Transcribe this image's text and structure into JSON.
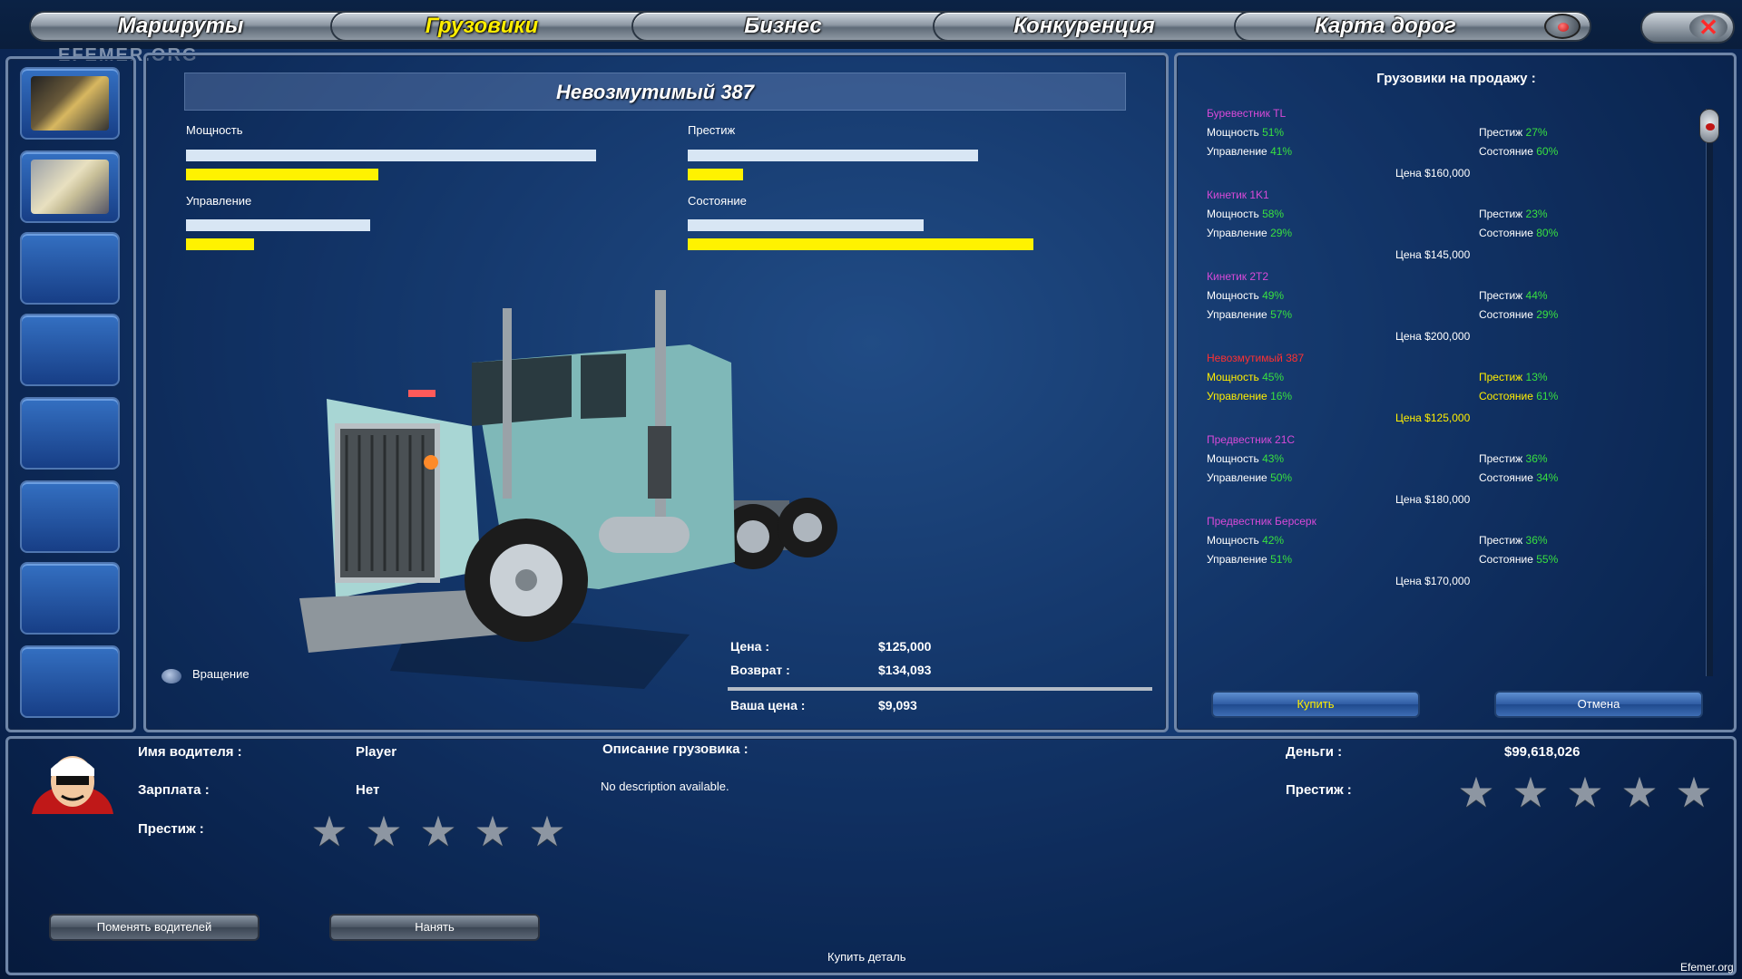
{
  "nav": {
    "tabs": [
      {
        "label": "Маршруты",
        "active": false
      },
      {
        "label": "Грузовики",
        "active": true
      },
      {
        "label": "Бизнес",
        "active": false
      },
      {
        "label": "Конкуренция",
        "active": false
      },
      {
        "label": "Карта дорог",
        "active": false
      }
    ],
    "watermark": "EFEMER.ORG"
  },
  "truck": {
    "title": "Невозмутимый 387",
    "stats": {
      "power_label": "Мощность",
      "prestige_label": "Престиж",
      "handling_label": "Управление",
      "condition_label": "Состояние",
      "power_value": 0.47,
      "prestige_value": 0.19,
      "handling_value": 0.37,
      "condition_value": 1.0
    },
    "rotation_label": "Вращение",
    "price_label": "Цена :",
    "price_value": "$125,000",
    "return_label": "Возврат :",
    "return_value": "$134,093",
    "your_price_label": "Ваша цена :",
    "your_price_value": "$9,093"
  },
  "sale": {
    "heading": "Грузовики на продажу :",
    "items": [
      {
        "name": "Буревестник TL",
        "power_k": "Мощность",
        "power": "51%",
        "prestige_k": "Престиж",
        "prestige": "27%",
        "handling_k": "Управление",
        "handling": "41%",
        "condition_k": "Состояние",
        "condition": "60%",
        "price": "Цена $160,000"
      },
      {
        "name": "Кинетик 1K1",
        "power_k": "Мощность",
        "power": "58%",
        "prestige_k": "Престиж",
        "prestige": "23%",
        "handling_k": "Управление",
        "handling": "29%",
        "condition_k": "Состояние",
        "condition": "80%",
        "price": "Цена $145,000"
      },
      {
        "name": "Кинетик 2T2",
        "power_k": "Мощность",
        "power": "49%",
        "prestige_k": "Престиж",
        "prestige": "44%",
        "handling_k": "Управление",
        "handling": "57%",
        "condition_k": "Состояние",
        "condition": "29%",
        "price": "Цена $200,000"
      },
      {
        "name": "Невозмутимый 387",
        "power_k": "Мощность",
        "power": "45%",
        "prestige_k": "Престиж",
        "prestige": "13%",
        "handling_k": "Управление",
        "handling": "16%",
        "condition_k": "Состояние",
        "condition": "61%",
        "price": "Цена $125,000"
      },
      {
        "name": "Предвестник 21C",
        "power_k": "Мощность",
        "power": "43%",
        "prestige_k": "Престиж",
        "prestige": "36%",
        "handling_k": "Управление",
        "handling": "50%",
        "condition_k": "Состояние",
        "condition": "34%",
        "price": "Цена $180,000"
      },
      {
        "name": "Предвестник Берсерк",
        "power_k": "Мощность",
        "power": "42%",
        "prestige_k": "Престиж",
        "prestige": "36%",
        "handling_k": "Управление",
        "handling": "51%",
        "condition_k": "Состояние",
        "condition": "55%",
        "price": "Цена $170,000"
      }
    ],
    "buy_label": "Купить",
    "cancel_label": "Отмена"
  },
  "driver": {
    "name_label": "Имя водителя :",
    "name_value": "Player",
    "salary_label": "Зарплата :",
    "salary_value": "Нет",
    "prestige_label": "Престиж :",
    "change_label": "Поменять водителей",
    "hire_label": "Нанять"
  },
  "description": {
    "label": "Описание грузовика :",
    "text": "No description available."
  },
  "money": {
    "label": "Деньги :",
    "value": "$99,618,026",
    "prestige_label": "Престиж :"
  },
  "buy_part_label": "Купить деталь",
  "footer_text": "Efemer.org",
  "colors": {
    "accent_yellow": "#ffee00",
    "value_green": "#38e040",
    "name_magenta": "#d84ad8",
    "selected_red": "#ff3030",
    "panel_border": "#6f86a8"
  }
}
